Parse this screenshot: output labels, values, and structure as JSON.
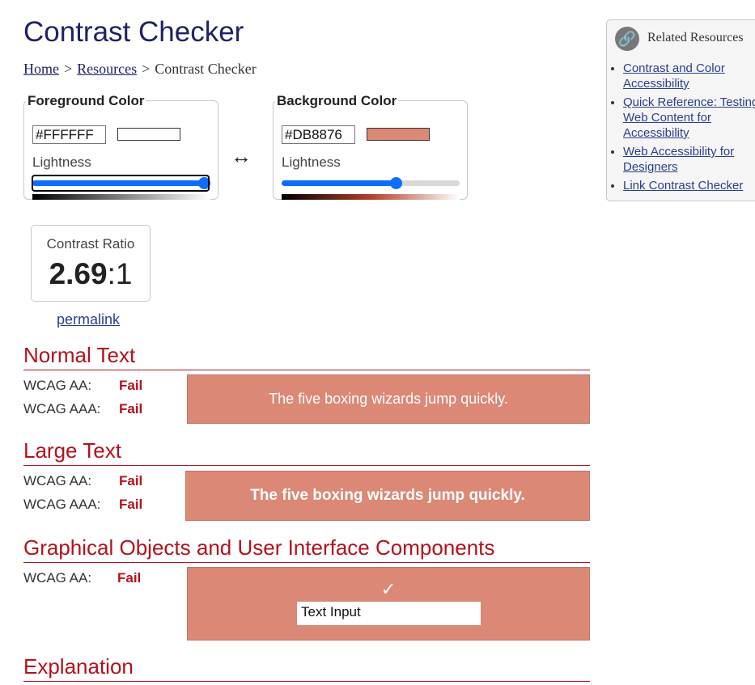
{
  "page": {
    "title": "Contrast Checker"
  },
  "breadcrumb": {
    "home": "Home",
    "resources": "Resources",
    "current": "Contrast Checker",
    "separator": ">"
  },
  "foreground": {
    "legend": "Foreground Color",
    "hex": "#FFFFFF",
    "swatch_color": "#FFFFFF",
    "lightness_label": "Lightness",
    "lightness": 1.0
  },
  "background": {
    "legend": "Background Color",
    "hex": "#DB8876",
    "swatch_color": "#DB8876",
    "lightness_label": "Lightness",
    "lightness": 0.65
  },
  "swap": {
    "icon": "swap-arrows-icon",
    "glyph": "↔"
  },
  "contrast": {
    "label": "Contrast Ratio",
    "value": "2.69",
    "suffix": ":1"
  },
  "permalink": "permalink",
  "normal_text": {
    "heading": "Normal Text",
    "rows": [
      {
        "label": "WCAG AA:",
        "result": "Fail"
      },
      {
        "label": "WCAG AAA:",
        "result": "Fail"
      }
    ],
    "sample": "The five boxing wizards jump quickly."
  },
  "large_text": {
    "heading": "Large Text",
    "rows": [
      {
        "label": "WCAG AA:",
        "result": "Fail"
      },
      {
        "label": "WCAG AAA:",
        "result": "Fail"
      }
    ],
    "sample": "The five boxing wizards jump quickly."
  },
  "graphical": {
    "heading": "Graphical Objects and User Interface Components",
    "rows": [
      {
        "label": "WCAG AA:",
        "result": "Fail"
      }
    ],
    "check": "✓",
    "input_value": "Text Input"
  },
  "explanation": {
    "heading": "Explanation"
  },
  "sidebar": {
    "title": "Related Resources",
    "icon": "link-icon",
    "links": [
      "Contrast and Color Accessibility",
      "Quick Reference: Testing Web Content for Accessibility",
      "Web Accessibility for Designers",
      "Link Contrast Checker"
    ]
  },
  "colors": {
    "sample_bg": "#DB8876",
    "fail": "#B3121D",
    "heading": "#1F2363",
    "link": "#2A3F8C",
    "slider": "#0D6EFD"
  }
}
